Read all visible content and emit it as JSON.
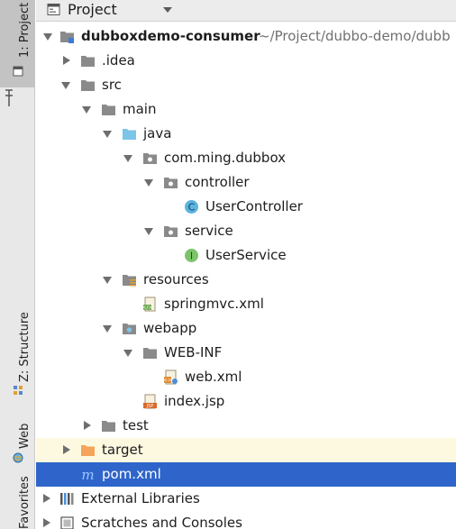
{
  "toolstrip": {
    "project_tab": "1: Project",
    "structure_tab": "Z: Structure",
    "web_tab": "Web",
    "favorites_tab": "Favorites"
  },
  "header": {
    "title": "Project",
    "icon": "project-view-icon",
    "dropdown_icon": "caret-down-icon"
  },
  "tree": {
    "root": {
      "label": "dubboxdemo-consumer",
      "path": "~/Project/dubbo-demo/dubb"
    },
    "idea": "idea",
    "idea_label": ".idea",
    "src": "src",
    "main": "main",
    "java": "java",
    "package": "com.ming.dubbox",
    "controller": "controller",
    "user_controller": "UserController",
    "service": "service",
    "user_service": "UserService",
    "resources": "resources",
    "springmvc": "springmvc.xml",
    "webapp": "webapp",
    "webinf": "WEB-INF",
    "webxml": "web.xml",
    "indexjsp": "index.jsp",
    "test": "test",
    "target": "target",
    "pom": "pom.xml",
    "external_libraries": "External Libraries",
    "scratches": "Scratches and Consoles"
  },
  "colors": {
    "selection": "#2f65ca",
    "target_highlight": "#fdf9e1",
    "folder_gray": "#8a8a8a",
    "folder_blue": "#7cc4e8",
    "folder_orange": "#f4a55a",
    "class_icon": "#5ab4de",
    "interface_icon": "#7cc46a"
  }
}
